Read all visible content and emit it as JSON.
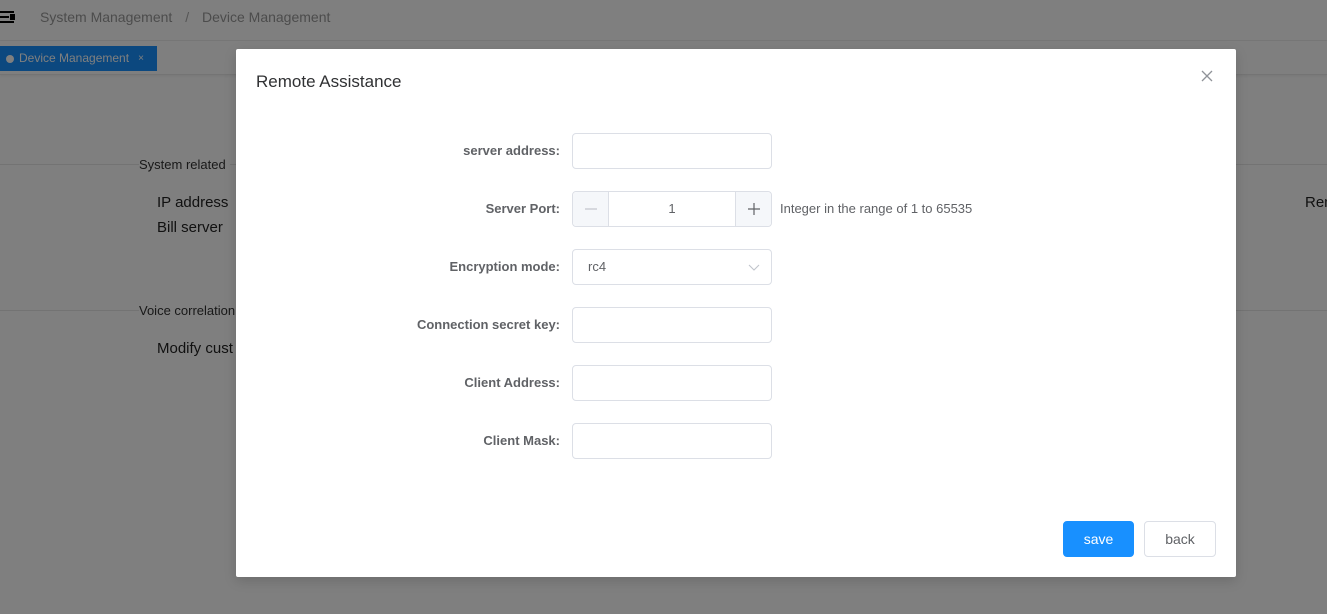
{
  "header": {
    "menu_icon": "hamburger-collapse-icon",
    "breadcrumb": [
      "System Management",
      "Device Management"
    ],
    "breadcrumb_separator": "/"
  },
  "tabs": [
    {
      "label": "Device Management",
      "active": true,
      "close_glyph": "×"
    }
  ],
  "background_page": {
    "sections": [
      {
        "title": "System related",
        "items": [
          "IP address",
          "Bill server"
        ],
        "right_item_partial": "Rem"
      },
      {
        "title": "Voice correlation",
        "items": [
          "Modify cust"
        ]
      }
    ]
  },
  "modal": {
    "title": "Remote Assistance",
    "close_icon": "close-icon",
    "fields": [
      {
        "label": "server address:",
        "type": "text",
        "value": ""
      },
      {
        "label": "Server Port:",
        "type": "number",
        "value": "1",
        "hint": "Integer in the range of 1 to 65535",
        "decrement_glyph": "−",
        "increment_glyph": "+"
      },
      {
        "label": "Encryption mode:",
        "type": "select",
        "value": "rc4"
      },
      {
        "label": "Connection secret key:",
        "type": "text",
        "value": ""
      },
      {
        "label": "Client Address:",
        "type": "text",
        "value": ""
      },
      {
        "label": "Client Mask:",
        "type": "text",
        "value": ""
      }
    ],
    "buttons": {
      "save": "save",
      "back": "back"
    }
  },
  "colors": {
    "primary": "#1890ff",
    "overlay": "rgba(0,0,0,0.5)",
    "label": "#606266",
    "border": "#dcdfe6"
  }
}
